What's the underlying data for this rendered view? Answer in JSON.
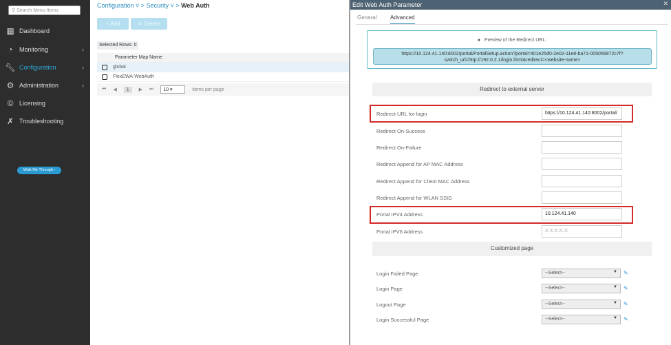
{
  "sidebar": {
    "search_placeholder": "Search Menu Items",
    "items": [
      {
        "label": "Dashboard",
        "icon": "dashboard-icon"
      },
      {
        "label": "Monitoring",
        "icon": "gauge-icon"
      },
      {
        "label": "Configuration",
        "icon": "wrench-icon"
      },
      {
        "label": "Administration",
        "icon": "gear-icon"
      },
      {
        "label": "Licensing",
        "icon": "licensing-icon"
      },
      {
        "label": "Troubleshooting",
        "icon": "tools-icon"
      }
    ],
    "walk_me": "Walk Me Through ›"
  },
  "breadcrumb": {
    "c1": "Configuration",
    "c2": "Security",
    "current": "Web Auth"
  },
  "toolbar": {
    "add": "+ Add",
    "delete": "✕ Delete"
  },
  "selected_rows": "Selected Rows: 0",
  "table": {
    "header": "Parameter Map Name",
    "rows": [
      "global",
      "FlexEWA-WebAuth"
    ]
  },
  "pager": {
    "page": "1",
    "per_page": "10",
    "per_page_label": "items per page"
  },
  "modal": {
    "title": "Edit Web Auth Parameter",
    "tabs": [
      "General",
      "Advanced"
    ],
    "preview_label": "Preview of the Redirect URL:",
    "preview_url_1": "https://10.124.41.140:8002/portal/PortalSetup.action?portal=401e25d0-2e02-11e8-ba71-005056872c7f?",
    "preview_url_2": "switch_url=http://192.0.2.1/login.html&redirect=<website-name>",
    "section1": "Redirect to external server",
    "fields": [
      {
        "label": "Redirect URL for login",
        "value": "https://10.124.41.140:8002/portal/"
      },
      {
        "label": "Redirect On-Success",
        "value": ""
      },
      {
        "label": "Redirect On-Failure",
        "value": ""
      },
      {
        "label": "Redirect Append for AP MAC Address",
        "value": ""
      },
      {
        "label": "Redirect Append for Client MAC Address",
        "value": ""
      },
      {
        "label": "Redirect Append for WLAN SSID",
        "value": ""
      },
      {
        "label": "Portal IPV4 Address",
        "value": "10.124.41.140"
      },
      {
        "label": "Portal IPV6 Address",
        "value": "",
        "placeholder": "X:X:X:X::X"
      }
    ],
    "section2": "Customized page",
    "selects": [
      {
        "label": "Login Failed Page",
        "value": "--Select--"
      },
      {
        "label": "Login Page",
        "value": "--Select--"
      },
      {
        "label": "Logout Page",
        "value": "--Select--"
      },
      {
        "label": "Login Successful Page",
        "value": "--Select--"
      }
    ]
  }
}
